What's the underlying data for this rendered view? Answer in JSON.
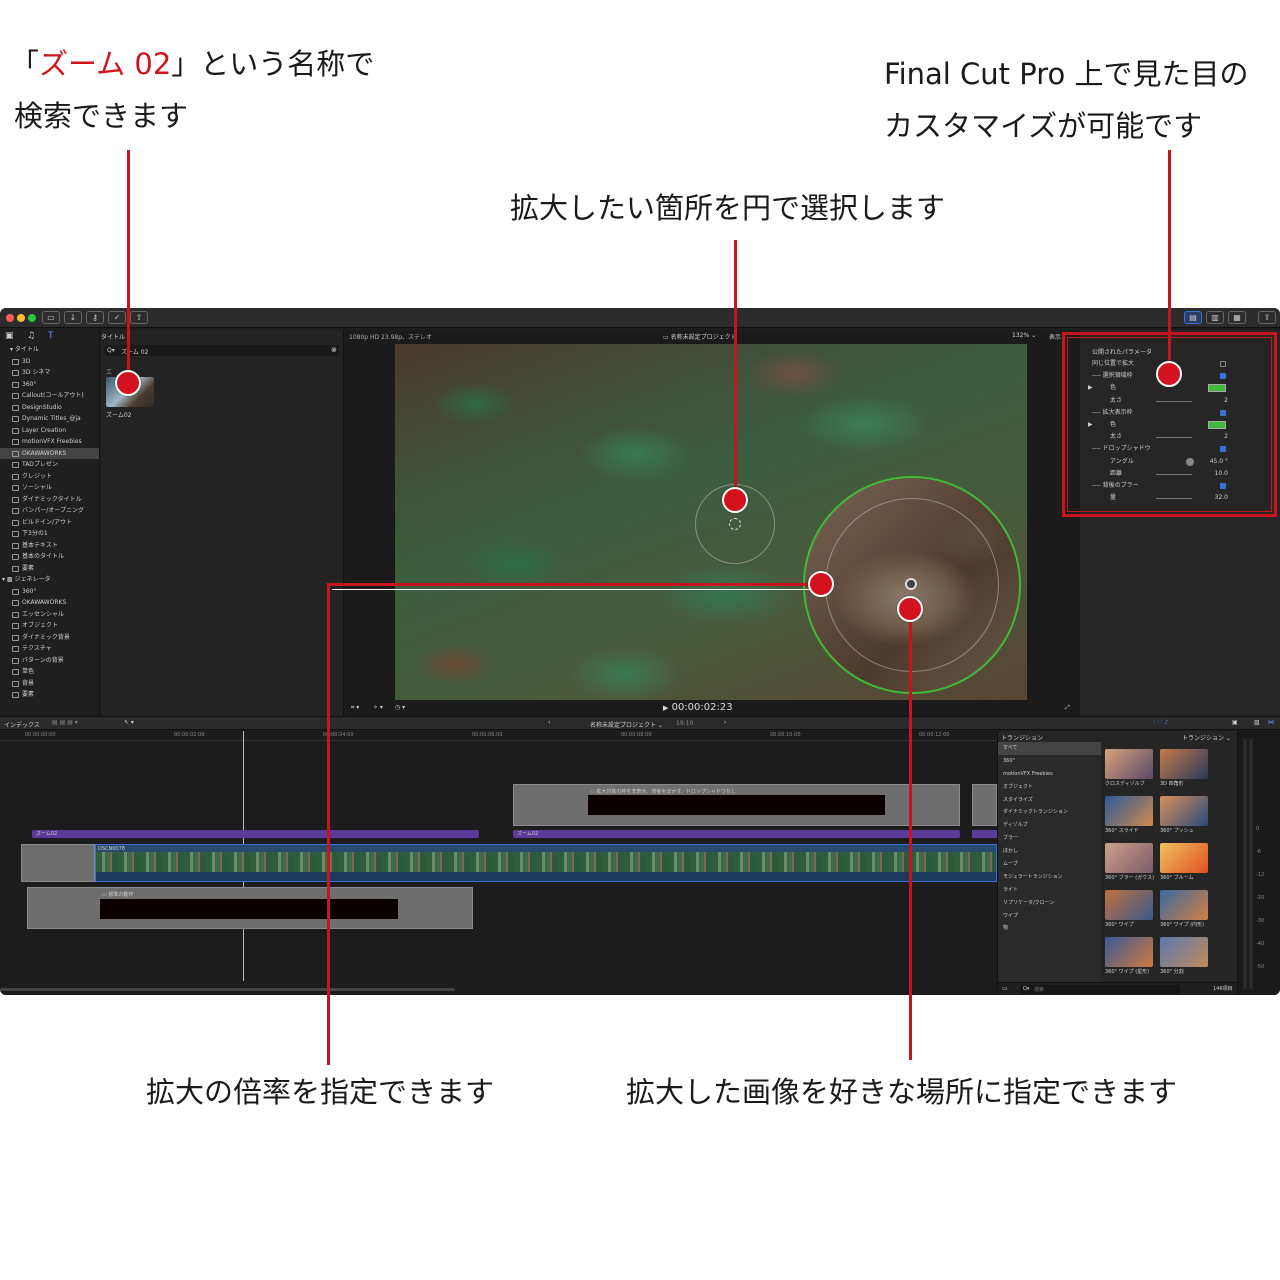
{
  "callouts": {
    "top_left_line1_prefix": "「",
    "top_left_line1_red": "ズーム 02",
    "top_left_line1_suffix": "」という名称で",
    "top_left_line2": "検索できます",
    "top_right_line1": "Final Cut Pro 上で見た目の",
    "top_right_line2": "カスタマイズが可能です",
    "top_center": "拡大したい箇所を円で選択します",
    "bottom_left": "拡大の倍率を指定できます",
    "bottom_right": "拡大した画像を好きな場所に指定できます"
  },
  "library": {
    "header": "タイトル",
    "titles_items": [
      "3D",
      "3D シネマ",
      "360°",
      "Callout(コールアウト)",
      "DesignStudio",
      "Dynamic Titles_@ja",
      "Layer Creation",
      "motionVFX Freebies",
      "OKAWAWORKS",
      "TADプレゼン",
      "クレジット",
      "ソーシャル",
      "ダイナミックタイトル",
      "バンパー/オープニング",
      "ビルドイン/アウト",
      "下3分の1",
      "基本テキスト",
      "基本のタイトル",
      "要素"
    ],
    "selected_item": "OKAWAWORKS",
    "generators_header": "ジェネレータ",
    "generators_items": [
      "360°",
      "OKAWAWORKS",
      "エッセンシャル",
      "オブジェクト",
      "ダイナミック背景",
      "テクスチャ",
      "パターンの背景",
      "単色",
      "背景",
      "要素"
    ]
  },
  "browser": {
    "tab_label": "タイトル",
    "search_value": "ズーム 02",
    "section_label": "エ",
    "result_label": "ズーム02"
  },
  "viewer": {
    "format": "1080p HD 23.98p、ステレオ",
    "project_title": "名称未設定プロジェクト",
    "zoom": "132%",
    "view_menu": "表示",
    "timecode": "00:00:02:23"
  },
  "inspector": {
    "header": "公開されたパラメータ",
    "rows": [
      {
        "label": "同じ位置で拡大",
        "type": "check",
        "checked": false
      },
      {
        "label": "---- 選択領域枠",
        "type": "check",
        "checked": true
      },
      {
        "label": "色",
        "type": "color",
        "color": "#3fb93a",
        "indent": true
      },
      {
        "label": "太さ",
        "type": "slider",
        "value": "2",
        "indent": true
      },
      {
        "label": "---- 拡大表示枠",
        "type": "check",
        "checked": true
      },
      {
        "label": "色",
        "type": "color",
        "color": "#3fb93a",
        "indent": true
      },
      {
        "label": "太さ",
        "type": "slider",
        "value": "2",
        "indent": true
      },
      {
        "label": "---- ドロップシャドウ",
        "type": "check",
        "checked": true
      },
      {
        "label": "アングル",
        "type": "knob",
        "value": "45.0 °",
        "indent": true
      },
      {
        "label": "距離",
        "type": "slider",
        "value": "10.0",
        "indent": true
      },
      {
        "label": "---- 背後のブラー",
        "type": "check",
        "checked": true
      },
      {
        "label": "量",
        "type": "slider",
        "value": "32.0",
        "indent": true
      }
    ]
  },
  "timeline": {
    "index_label": "インデックス",
    "project_title": "名称未設定プロジェクト",
    "duration": "19:10",
    "ruler": [
      "00:00:00:00",
      "00:00:02:00",
      "00:00:04:00",
      "00:00:06:00",
      "00:00:08:00",
      "00:00:10:00",
      "00:00:12:00"
    ],
    "clip_zoom_a": "ズーム02",
    "clip_zoom_b": "ズーム02",
    "clip_video": "DSCN0078",
    "clip_title_top": "拡大対象の枠を非表示、背後をぼかす、ドロップシャドウなし",
    "clip_title_bottom": "標準の動作"
  },
  "transitions": {
    "header": "トランジション",
    "dropdown": "トランジション",
    "categories": [
      "すべて",
      "360°",
      "motionVFX Freebies",
      "オブジェクト",
      "スタイライズ",
      "ダイナミックトランジション",
      "ディゾルブ",
      "ブラー",
      "ぼかし",
      "ムーブ",
      "モジュラートランジション",
      "ライト",
      "リプリケータ/クローン",
      "ワイプ",
      "物"
    ],
    "selected_category": "すべて",
    "thumbs": [
      "クロスディゾルブ",
      "3D 四角形",
      "360° スライド",
      "360° プッシュ",
      "360° ブラー (ガウス)",
      "360° ブルーム",
      "360° ワイプ",
      "360° ワイプ (円形)",
      "360° ワイプ (星形)",
      "360° 分割"
    ],
    "search_placeholder": "検索",
    "count": "146項目"
  },
  "meters": {
    "ticks": [
      "0",
      "-6",
      "-12",
      "-20",
      "-30",
      "-40",
      "-50"
    ]
  },
  "colors": {
    "accent_red": "#d4121f",
    "zoom_ring_green": "#3fb93a",
    "zoom_clip_purple": "#5b3a9a",
    "selection_blue": "#3b6fd9"
  }
}
